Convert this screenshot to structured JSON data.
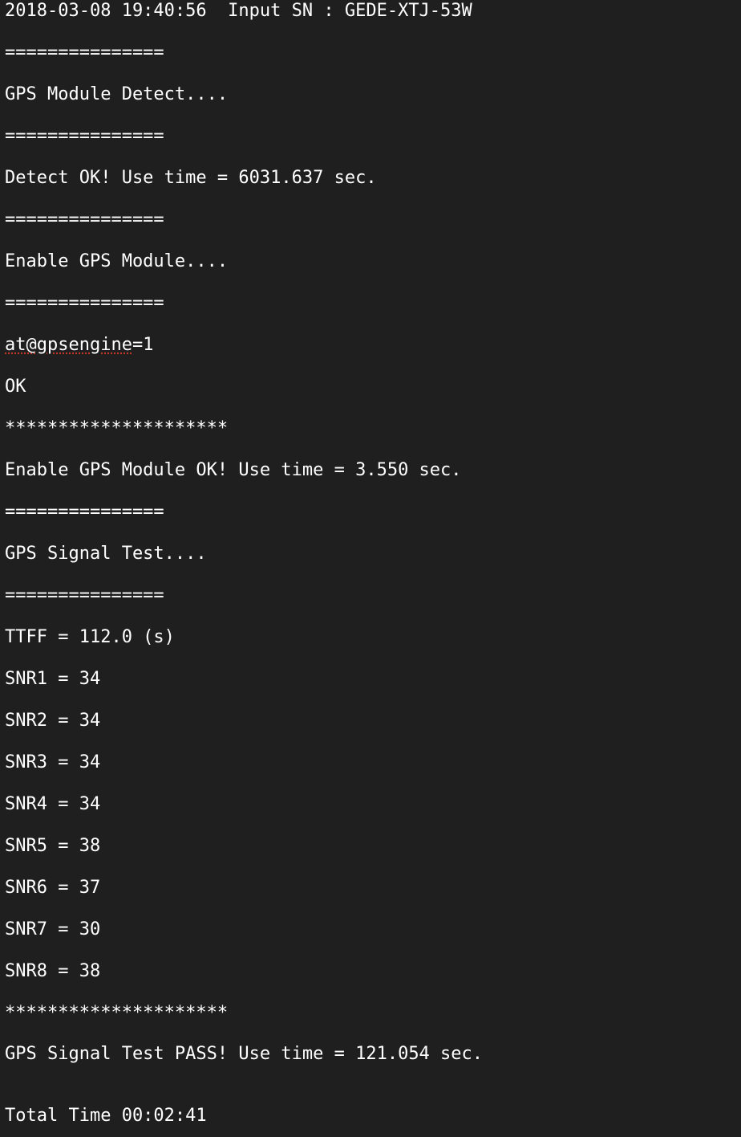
{
  "terminal": {
    "header": "2018-03-08 19:40:56  Input SN : GEDE-XTJ-53W",
    "sep1": "===============",
    "detect_title": "GPS Module Detect....",
    "sep2": "===============",
    "detect_ok": "Detect OK! Use time = 6031.637 sec.",
    "sep3": "===============",
    "enable_title": "Enable GPS Module....",
    "sep4": "===============",
    "cmd_name": "at@gpsengine",
    "cmd_value": "=1",
    "cmd_response": "OK",
    "stars1": "*********************",
    "enable_ok": "Enable GPS Module OK! Use time = 3.550 sec.",
    "sep5": "===============",
    "signal_title": "GPS Signal Test....",
    "sep6": "===============",
    "ttff": "TTFF = 112.0 (s)",
    "snr1": "SNR1 = 34",
    "snr2": "SNR2 = 34",
    "snr3": "SNR3 = 34",
    "snr4": "SNR4 = 34",
    "snr5": "SNR5 = 38",
    "snr6": "SNR6 = 37",
    "snr7": "SNR7 = 30",
    "snr8": "SNR8 = 38",
    "stars2": "*********************",
    "signal_pass": "GPS Signal Test PASS! Use time = 121.054 sec.",
    "total_time": "Total Time 00:02:41"
  },
  "colors": {
    "background": "#1f1f1f",
    "text": "#ffffff"
  }
}
